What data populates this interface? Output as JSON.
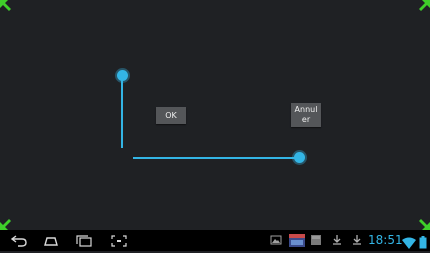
{
  "dialog": {
    "ok_label": "OK",
    "cancel_label": "Annuler"
  },
  "status_bar": {
    "time": "18:51"
  },
  "icons": {
    "corner": "resize-corner-icon",
    "nav_back": "back-icon",
    "nav_home": "home-icon",
    "nav_recent": "recent-apps-icon",
    "nav_screenshot": "screenshot-icon",
    "wifi": "wifi-icon",
    "battery": "battery-icon"
  },
  "colors": {
    "accent": "#33b5e5",
    "corner_green": "#3fcf2a",
    "background": "#1f2124",
    "button": "#545659"
  }
}
